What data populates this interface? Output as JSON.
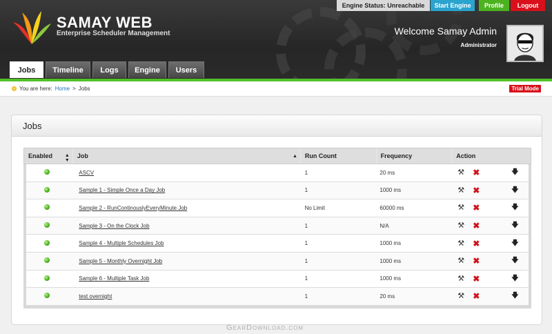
{
  "brand": {
    "title": "SAMAY WEB",
    "subtitle": "Enterprise Scheduler Management"
  },
  "topbar": {
    "engine_status": "Engine Status: Unreachable",
    "start_engine": "Start Engine",
    "profile": "Profile",
    "logout": "Logout"
  },
  "user": {
    "welcome": "Welcome Samay Admin",
    "role": "Administrator"
  },
  "tabs": [
    {
      "label": "Jobs"
    },
    {
      "label": "Timeline"
    },
    {
      "label": "Logs"
    },
    {
      "label": "Engine"
    },
    {
      "label": "Users"
    }
  ],
  "breadcrumb": {
    "prefix": "You are here:",
    "home": "Home",
    "separator": ">",
    "current": "Jobs"
  },
  "trial": "Trial Mode",
  "panel": {
    "title": "Jobs"
  },
  "table": {
    "headers": {
      "enabled": "Enabled",
      "job": "Job",
      "run_count": "Run Count",
      "frequency": "Frequency",
      "action": "Action"
    },
    "rows": [
      {
        "job": "ASCV",
        "run_count": "1",
        "frequency": "20 ms"
      },
      {
        "job": "Sample 1 - Simple Once a Day Job",
        "run_count": "1",
        "frequency": "1000 ms"
      },
      {
        "job": "Sample 2 - RunContinouslyEveryMinute Job",
        "run_count": "No Limit",
        "frequency": "60000 ms"
      },
      {
        "job": "Sample 3 - On the Clock Job",
        "run_count": "1",
        "frequency": "N/A"
      },
      {
        "job": "Sample 4 - Multiple Schedules Job",
        "run_count": "1",
        "frequency": "1000 ms"
      },
      {
        "job": "Sample 5 - Monthly Overnight Job",
        "run_count": "1",
        "frequency": "1000 ms"
      },
      {
        "job": "Sample 6 - Multiple Task Job",
        "run_count": "1",
        "frequency": "1000 ms"
      },
      {
        "job": "test overnight",
        "run_count": "1",
        "frequency": "20 ms"
      }
    ]
  },
  "watermark": "GearDownload.com",
  "colors": {
    "accent_green": "#52c12a",
    "logout_red": "#d9101b",
    "start_blue": "#2aa4cf"
  }
}
